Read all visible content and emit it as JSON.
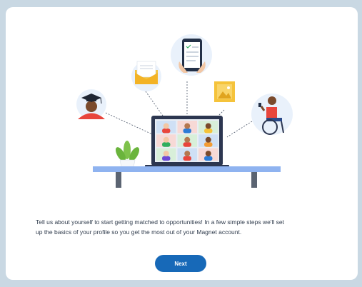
{
  "intro": {
    "line1": "Tell us about yourself to start getting matched to opportunities! In a few simple steps we'll set",
    "line2": "up the basics of your profile so you get the most out of your Magnet account."
  },
  "actions": {
    "next_label": "Next"
  },
  "colors": {
    "primary": "#1769b8",
    "page_background": "#c9d8e3",
    "card_background": "#ffffff",
    "shelf": "#8fb3f0",
    "laptop": "#2c3650",
    "accent_yellow": "#f5c33b"
  },
  "illustration": {
    "icons": [
      "graduate-avatar-icon",
      "envelope-icon",
      "phone-checklist-icon",
      "image-frame-icon",
      "wheelchair-user-avatar-icon",
      "plant-icon",
      "laptop-video-call-icon"
    ]
  }
}
